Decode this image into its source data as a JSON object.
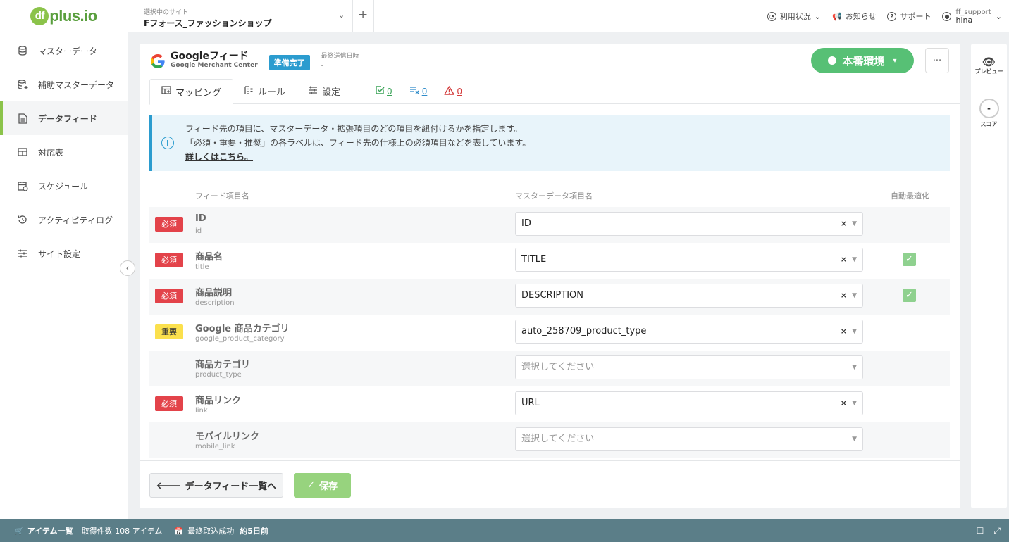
{
  "brand": {
    "logo_mark": "df",
    "logo_text": "plus.io"
  },
  "header": {
    "site_label": "選択中のサイト",
    "site_name": "Fフォース_ファッションショップ",
    "usage": "利用状況",
    "notice": "お知らせ",
    "support": "サポート",
    "user_id": "ff_support",
    "user_name": "hina"
  },
  "sidebar": {
    "items": [
      {
        "label": "マスターデータ",
        "icon": "database-icon"
      },
      {
        "label": "補助マスターデータ",
        "icon": "database-plus-icon"
      },
      {
        "label": "データフィード",
        "icon": "document-icon"
      },
      {
        "label": "対応表",
        "icon": "table-icon"
      },
      {
        "label": "スケジュール",
        "icon": "calendar-icon"
      },
      {
        "label": "アクティビティログ",
        "icon": "history-icon"
      },
      {
        "label": "サイト設定",
        "icon": "sliders-icon"
      }
    ],
    "active_index": 2
  },
  "feed": {
    "name": "Googleフィード",
    "subtitle": "Google Merchant Center",
    "status": "準備完了",
    "last_sent_label": "最終送信日時",
    "last_sent_value": "-",
    "env_label": "本番環境",
    "more": "···"
  },
  "tabs": {
    "mapping": "マッピング",
    "rules": "ルール",
    "settings": "設定",
    "ok_count": "0",
    "filter_count": "0",
    "warning_count": "0"
  },
  "info": {
    "line1": "フィード先の項目に、マスターデータ・拡張項目のどの項目を紐付けるかを指定します。",
    "line2": "「必須・重要・推奨」の各ラベルは、フィード先の仕様上の必須項目などを表しています。",
    "link": "詳しくはこちら。"
  },
  "columns": {
    "feed_item": "フィード項目名",
    "master_item": "マスターデータ項目名",
    "auto_opt": "自動最適化"
  },
  "placeholder": "選択してください",
  "rows": [
    {
      "badge": "必須",
      "badge_type": "req",
      "name": "ID",
      "key": "id",
      "value": "ID",
      "auto": false
    },
    {
      "badge": "必須",
      "badge_type": "req",
      "name": "商品名",
      "key": "title",
      "value": "TITLE",
      "auto": true
    },
    {
      "badge": "必須",
      "badge_type": "req",
      "name": "商品説明",
      "key": "description",
      "value": "DESCRIPTION",
      "auto": true
    },
    {
      "badge": "重要",
      "badge_type": "imp",
      "name": "Google 商品カテゴリ",
      "key": "google_product_category",
      "value": "auto_258709_product_type",
      "auto": false
    },
    {
      "badge": "",
      "badge_type": "",
      "name": "商品カテゴリ",
      "key": "product_type",
      "value": "",
      "auto": false
    },
    {
      "badge": "必須",
      "badge_type": "req",
      "name": "商品リンク",
      "key": "link",
      "value": "URL",
      "auto": false
    },
    {
      "badge": "",
      "badge_type": "",
      "name": "モバイルリンク",
      "key": "mobile_link",
      "value": "",
      "auto": false
    }
  ],
  "footer": {
    "back": "データフィード一覧へ",
    "save": "保存"
  },
  "rightrail": {
    "preview": "プレビュー",
    "score": "スコア",
    "score_value": "-"
  },
  "bottombar": {
    "items_label": "アイテム一覧",
    "count_label": "取得件数 108 アイテム",
    "last_import_label": "最終取込成功",
    "last_import_value": "約5日前"
  },
  "colors": {
    "accent": "#8bc34a",
    "env": "#57c075",
    "info": "#2b9ccf",
    "required": "#e3434a",
    "important": "#fbe04d",
    "bottombar": "#5b7e88"
  }
}
